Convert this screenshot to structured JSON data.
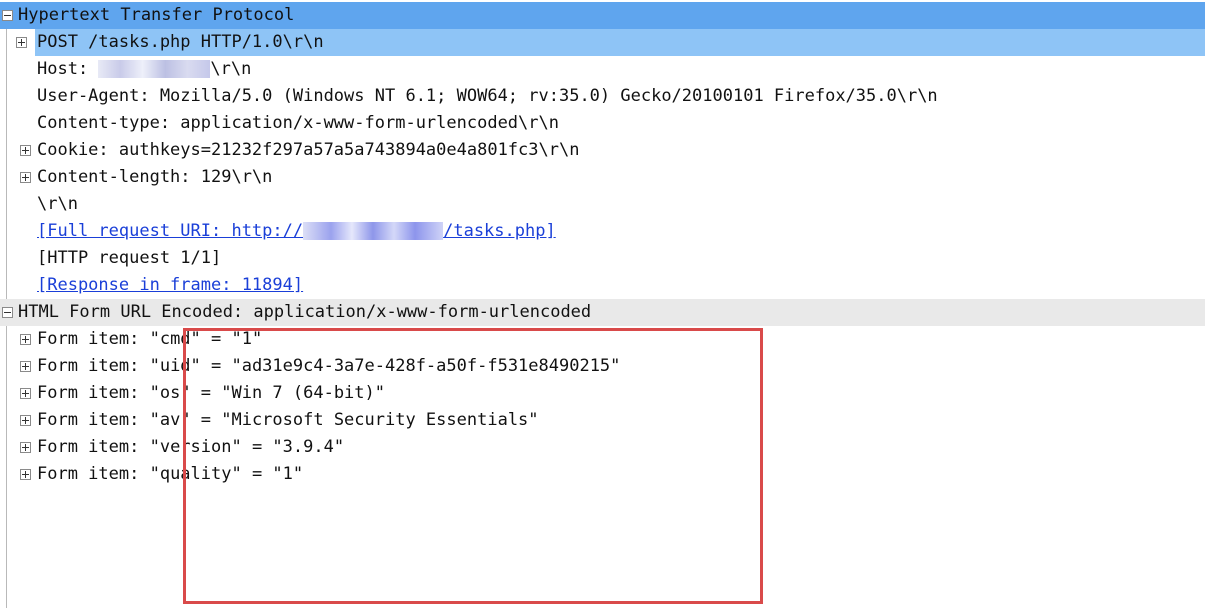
{
  "http": {
    "header": "Hypertext Transfer Protocol",
    "request_line": "POST /tasks.php HTTP/1.0\\r\\n",
    "host_prefix": "Host: ",
    "host_suffix": "\\r\\n",
    "user_agent": "User-Agent: Mozilla/5.0 (Windows NT 6.1; WOW64; rv:35.0) Gecko/20100101 Firefox/35.0\\r\\n",
    "content_type": "Content-type: application/x-www-form-urlencoded\\r\\n",
    "cookie": "Cookie: authkeys=21232f297a57a5a743894a0e4a801fc3\\r\\n",
    "content_length": "Content-length: 129\\r\\n",
    "crlf": "\\r\\n",
    "full_uri_prefix": "[Full request URI: http://",
    "full_uri_suffix": "/tasks.php]",
    "request_count": "[HTTP request 1/1]",
    "response_frame": "[Response in frame: 11894]"
  },
  "form": {
    "header": "HTML Form URL Encoded: application/x-www-form-urlencoded",
    "label": "Form item: ",
    "items": [
      "\"cmd\" = \"1\"",
      "\"uid\" = \"ad31e9c4-3a7e-428f-a50f-f531e8490215\"",
      "\"os\" = \"Win 7 (64-bit)\"",
      "\"av\" = \"Microsoft Security Essentials\"",
      "\"version\" = \"3.9.4\"",
      "\"quality\" = \"1\""
    ]
  },
  "colors": {
    "selection": "#5fa5ee",
    "selection_light": "#8ec4f6",
    "link": "#1a3fd8",
    "highlight_box": "#d94a4a"
  }
}
